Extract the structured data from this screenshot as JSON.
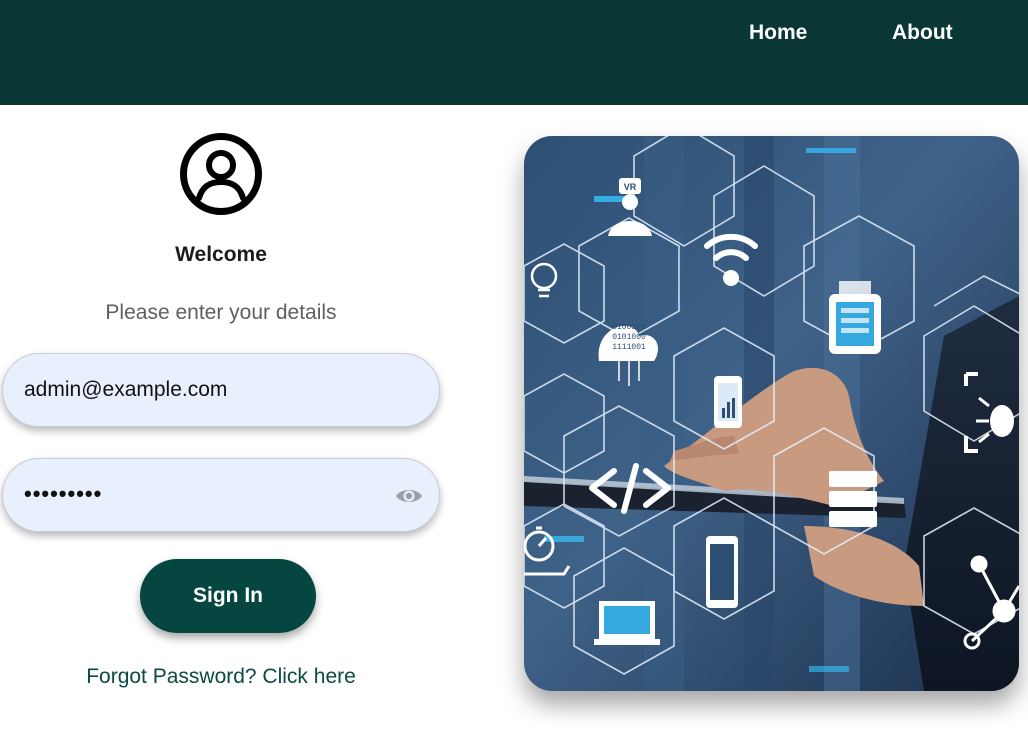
{
  "nav": {
    "home_label": "Home",
    "about_label": "About"
  },
  "login": {
    "avatar_icon": "user-circle-icon",
    "welcome": "Welcome",
    "subtitle": "Please enter your details",
    "email_value": "admin@example.com",
    "password_value": "•••••••••",
    "password_toggle_icon": "eye-icon",
    "signin_label": "Sign In",
    "forgot_label": "Forgot Password? Click here"
  },
  "hero": {
    "binary_1": "0100100",
    "binary_2": "0101000",
    "binary_3": "1111001",
    "vr_label": "VR",
    "icons": [
      "vr-person-icon",
      "wifi-icon",
      "smartwatch-icon",
      "lightbulb-icon",
      "cloud-icon",
      "smartphone-icon",
      "bug-icon",
      "code-icon",
      "server-icon",
      "stopwatch-icon",
      "laptop-icon",
      "network-icon"
    ]
  },
  "colors": {
    "nav_bg": "#0b3636",
    "input_bg": "#e8f0fe",
    "button_bg": "#054640",
    "link_color": "#0b4a44"
  }
}
